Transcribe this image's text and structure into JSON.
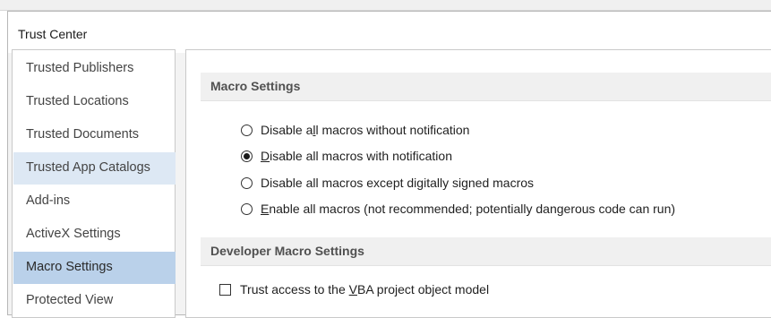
{
  "window": {
    "title": "Trust Center"
  },
  "sidebar": {
    "items": [
      {
        "label": "Trusted Publishers"
      },
      {
        "label": "Trusted Locations"
      },
      {
        "label": "Trusted Documents"
      },
      {
        "label": "Trusted App Catalogs"
      },
      {
        "label": "Add-ins"
      },
      {
        "label": "ActiveX Settings"
      },
      {
        "label": "Macro Settings"
      },
      {
        "label": "Protected View"
      }
    ],
    "selected": "Macro Settings",
    "hovered": "Trusted App Catalogs"
  },
  "macro_settings": {
    "header": "Macro Settings",
    "options": [
      {
        "pre": "Disable a",
        "key": "l",
        "post": "l macros without notification",
        "checked": false
      },
      {
        "pre": "",
        "key": "D",
        "post": "isable all macros with notification",
        "checked": true
      },
      {
        "pre": "Disable all macros except di",
        "key": "g",
        "post": "itally signed macros",
        "checked": false
      },
      {
        "pre": "",
        "key": "E",
        "post": "nable all macros (not recommended; potentially dangerous code can run)",
        "checked": false
      }
    ]
  },
  "developer_settings": {
    "header": "Developer Macro Settings",
    "vba_access": {
      "pre": "Trust access to the ",
      "key": "V",
      "post": "BA project object model",
      "checked": false
    }
  }
}
